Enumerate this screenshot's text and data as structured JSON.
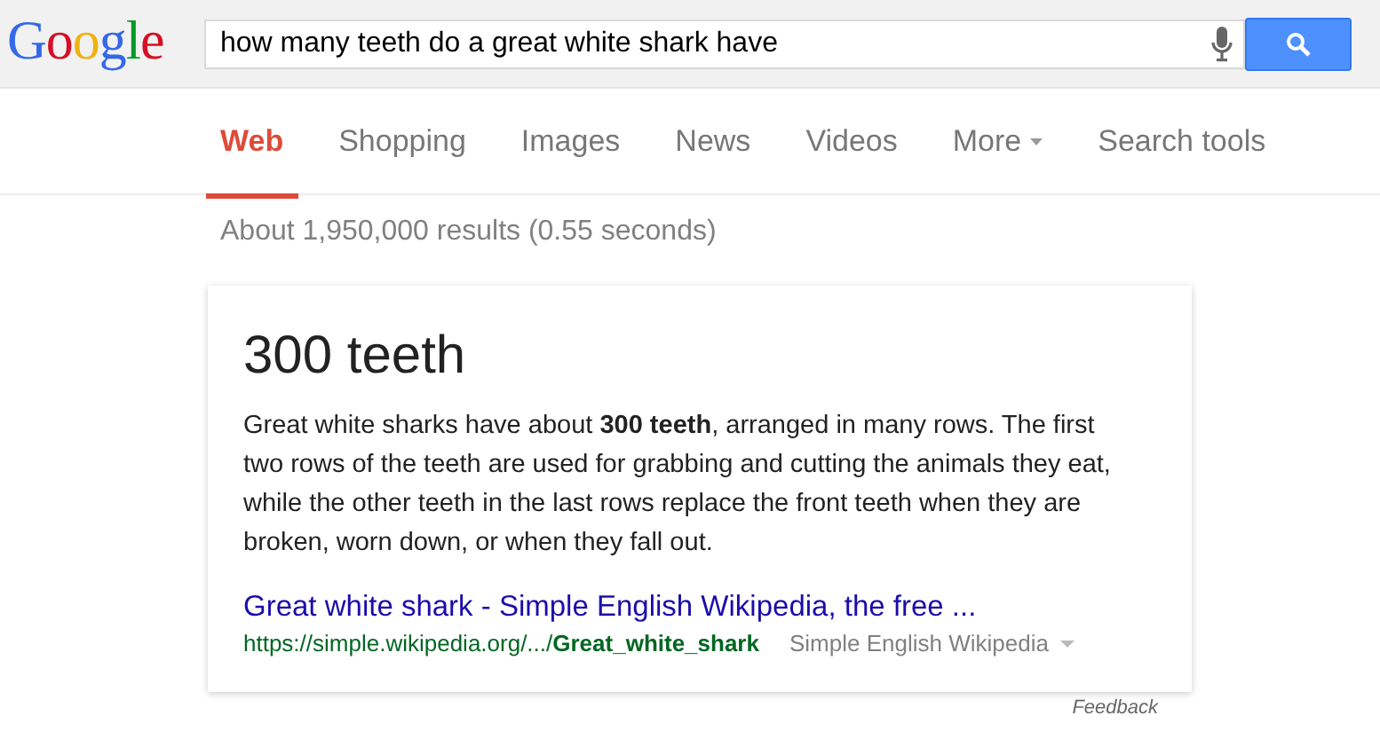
{
  "logo": "Google",
  "search": {
    "value": "how many teeth do a great white shark have"
  },
  "tabs": [
    {
      "label": "Web",
      "selected": true
    },
    {
      "label": "Shopping",
      "selected": false
    },
    {
      "label": "Images",
      "selected": false
    },
    {
      "label": "News",
      "selected": false
    },
    {
      "label": "Videos",
      "selected": false
    },
    {
      "label": "More",
      "selected": false,
      "kind": "menu"
    },
    {
      "label": "Search tools",
      "selected": false
    }
  ],
  "result_stats": "About 1,950,000 results (0.55 seconds)",
  "answer": {
    "title": "300 teeth",
    "text": "Great white sharks have about **300 teeth**, arranged in many rows. The first two rows of the teeth are used for grabbing and cutting the animals they eat, while the other teeth in the last rows replace the front teeth when they are broken, worn down, or when they fall out.",
    "link": "Great white shark - Simple English Wikipedia, the free ...",
    "url": "https://simple.wikipedia.org/.../**Great_white_shark**",
    "source": "Simple English Wikipedia"
  },
  "feedback": "Feedback"
}
